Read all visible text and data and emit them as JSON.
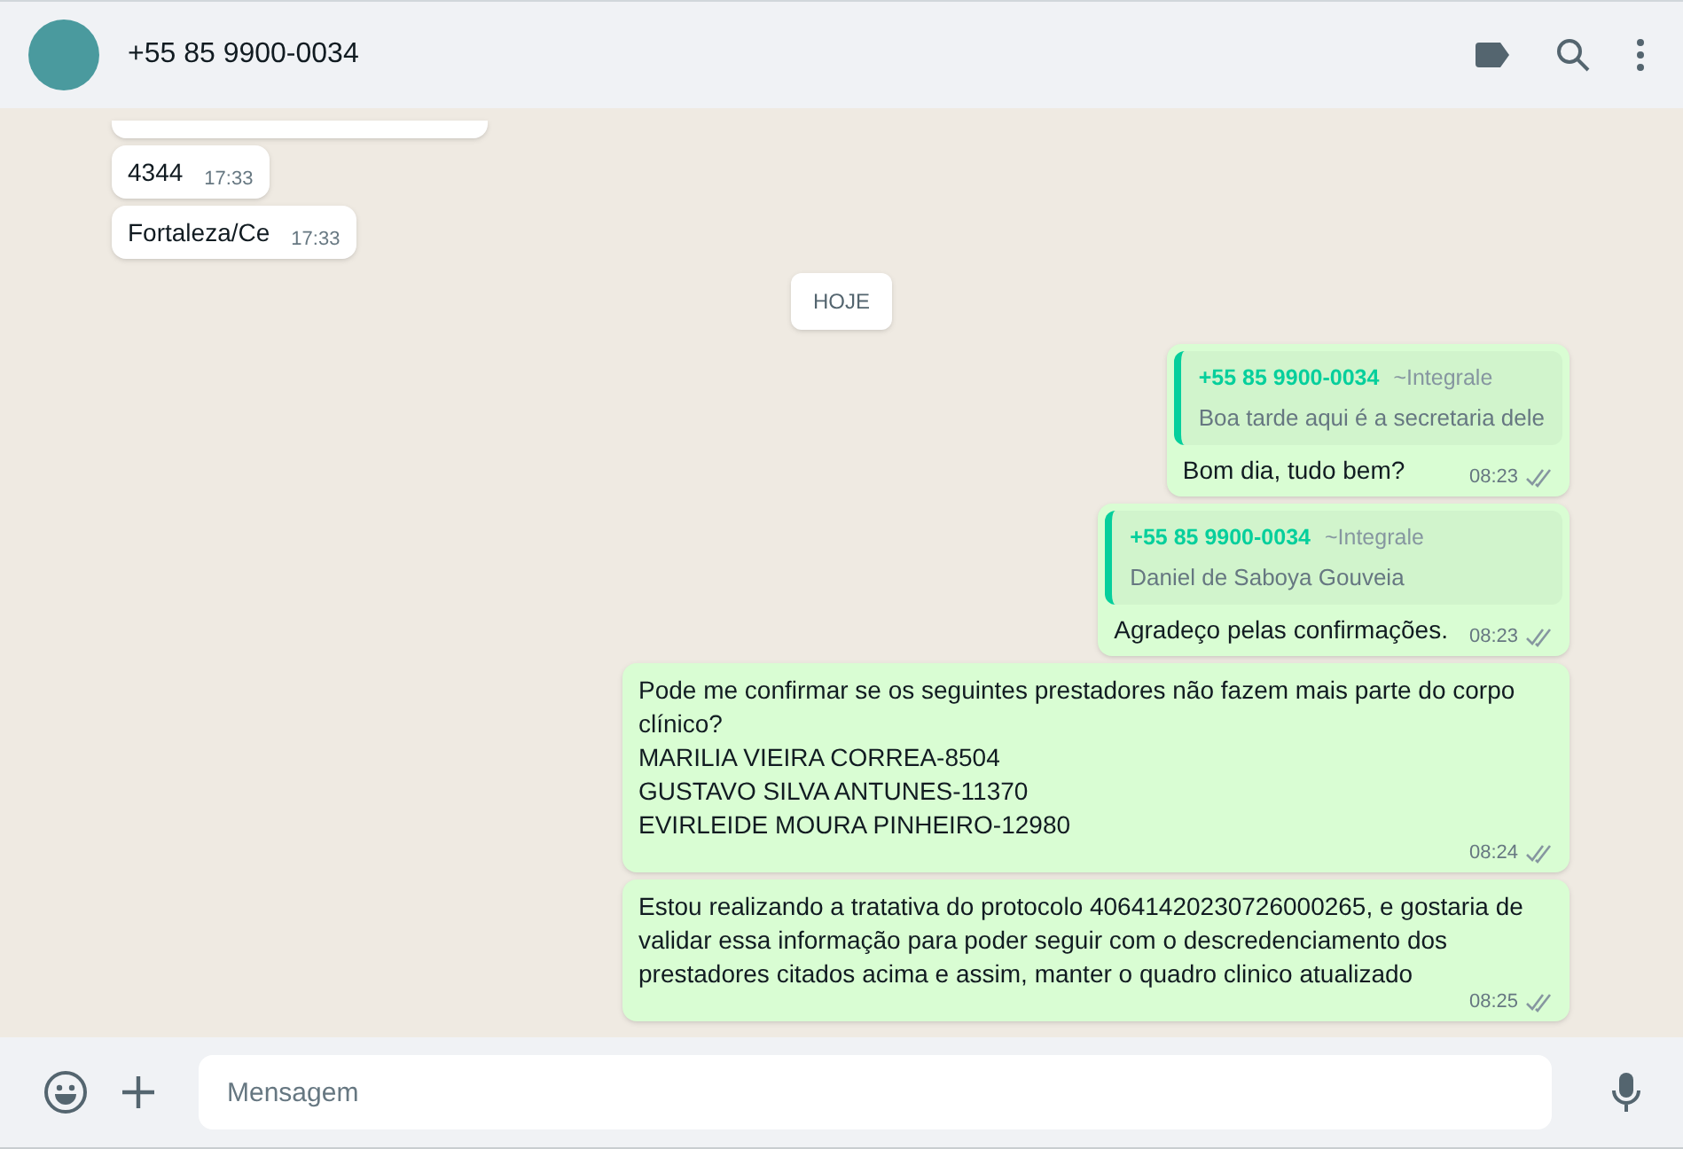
{
  "header": {
    "contact_name": "+55 85 9900-0034"
  },
  "messages": [
    {
      "kind": "cut",
      "outgoing": false
    },
    {
      "kind": "text",
      "outgoing": false,
      "text": "4344",
      "time": "17:33"
    },
    {
      "kind": "text",
      "outgoing": false,
      "text": "Fortaleza/Ce",
      "time": "17:33"
    },
    {
      "kind": "date",
      "text": "HOJE"
    },
    {
      "kind": "reply",
      "outgoing": true,
      "quote_author": "+55 85 9900-0034",
      "quote_alias": "~Integrale",
      "quote_text": "Boa tarde aqui é a secretaria dele",
      "text": "Bom dia, tudo bem?",
      "time": "08:23",
      "read": false
    },
    {
      "kind": "reply",
      "outgoing": true,
      "quote_author": "+55 85 9900-0034",
      "quote_alias": "~Integrale",
      "quote_text": "Daniel de Saboya Gouveia",
      "text": "Agradeço pelas confirmações.",
      "time": "08:23",
      "read": false
    },
    {
      "kind": "text",
      "outgoing": true,
      "text": "Pode me confirmar se os seguintes prestadores não fazem mais parte do corpo clínico?\nMARILIA VIEIRA CORREA-8504\nGUSTAVO SILVA ANTUNES-11370\nEVIRLEIDE MOURA PINHEIRO-12980",
      "time": "08:24",
      "read": false
    },
    {
      "kind": "text",
      "outgoing": true,
      "text": "Estou realizando a tratativa do protocolo 40641420230726000265, e gostaria de validar essa informação para poder seguir com o descredenciamento dos prestadores citados acima e assim, manter o quadro clinico atualizado",
      "time": "08:25",
      "read": false
    }
  ],
  "composer": {
    "placeholder": "Mensagem"
  }
}
